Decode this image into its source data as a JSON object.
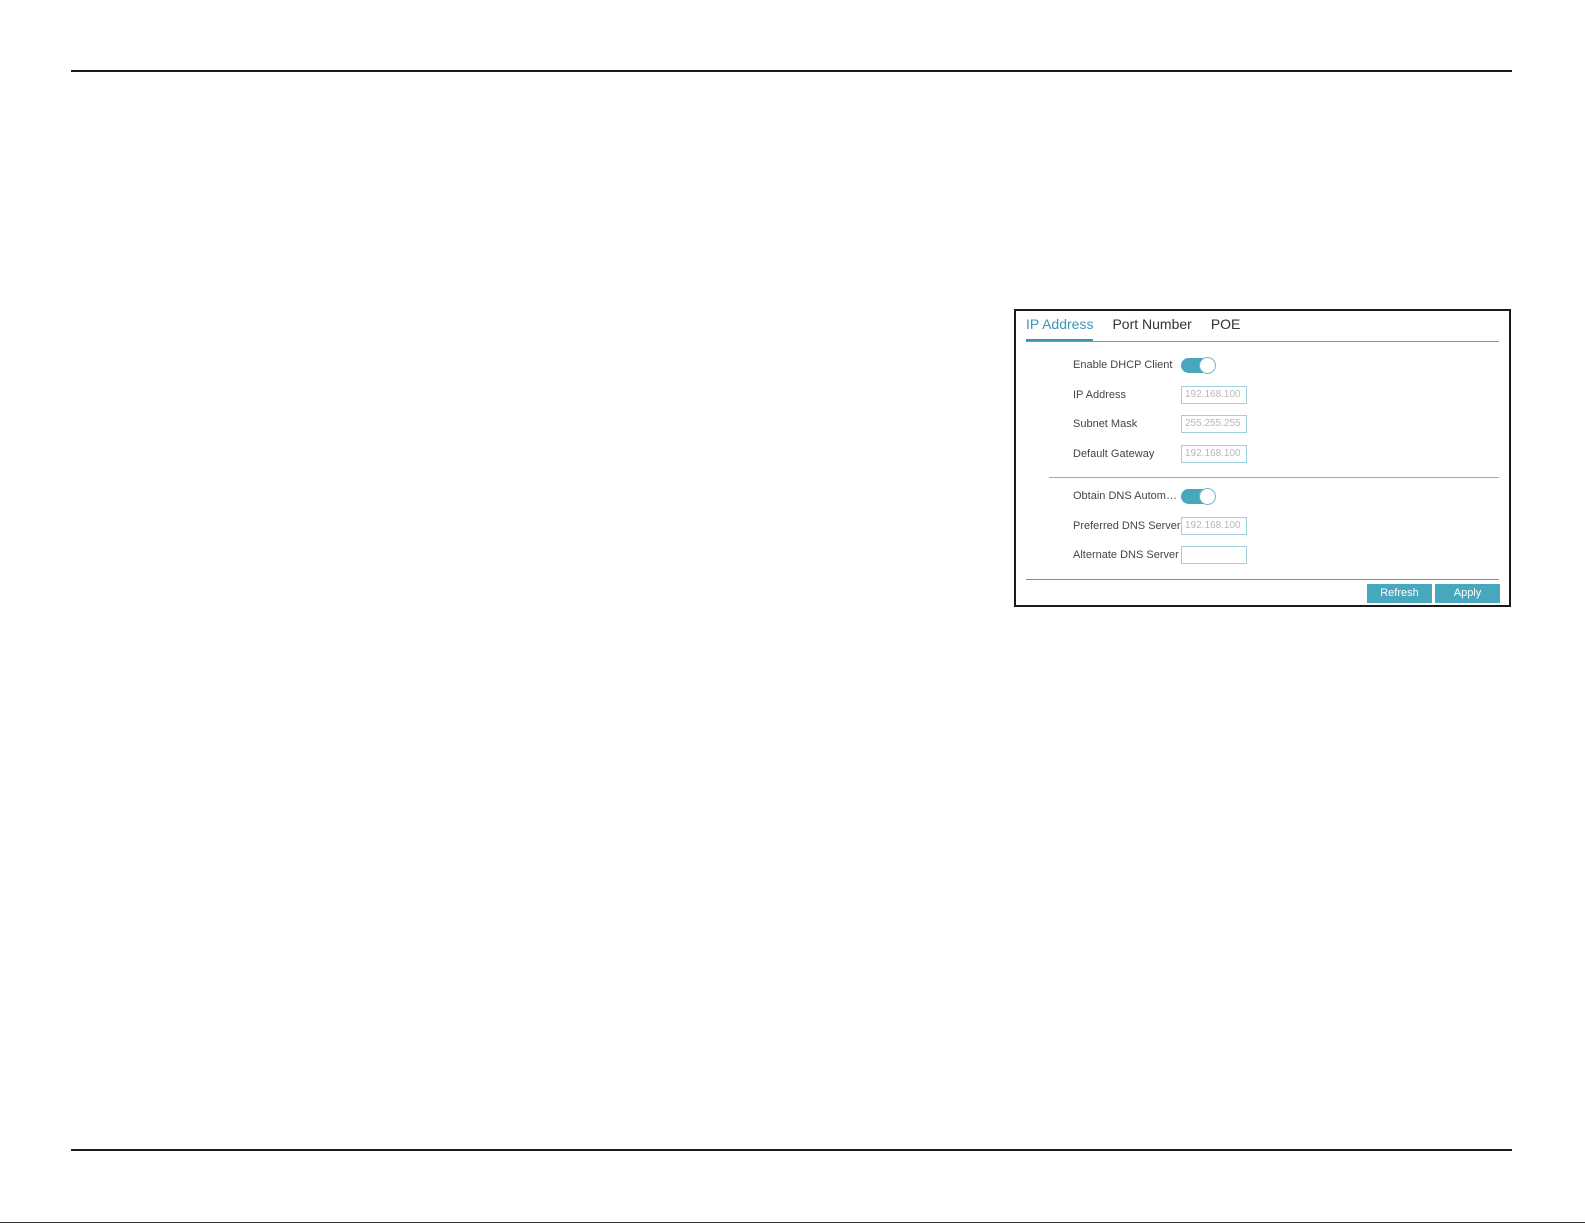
{
  "tabs": [
    {
      "label": "IP Address",
      "active": true
    },
    {
      "label": "Port Number",
      "active": false
    },
    {
      "label": "POE",
      "active": false
    }
  ],
  "fields": {
    "dhcp": {
      "label": "Enable DHCP Client",
      "enabled": true
    },
    "ip_address": {
      "label": "IP Address",
      "value": "192.168.100"
    },
    "subnet_mask": {
      "label": "Subnet Mask",
      "value": "255.255.255"
    },
    "default_gateway": {
      "label": "Default Gateway",
      "value": "192.168.100"
    },
    "obtain_dns": {
      "label": "Obtain DNS Automati...",
      "enabled": true
    },
    "preferred_dns": {
      "label": "Preferred DNS Server",
      "value": "192.168.100"
    },
    "alternate_dns": {
      "label": "Alternate DNS Server",
      "value": ""
    }
  },
  "buttons": {
    "refresh_label": "Refresh",
    "apply_label": "Apply"
  },
  "colors": {
    "accent": "#47a7bd",
    "active_tab": "#3b97b3",
    "field_border": "#9fd0dc",
    "placeholder_text": "#b8b8b8"
  }
}
